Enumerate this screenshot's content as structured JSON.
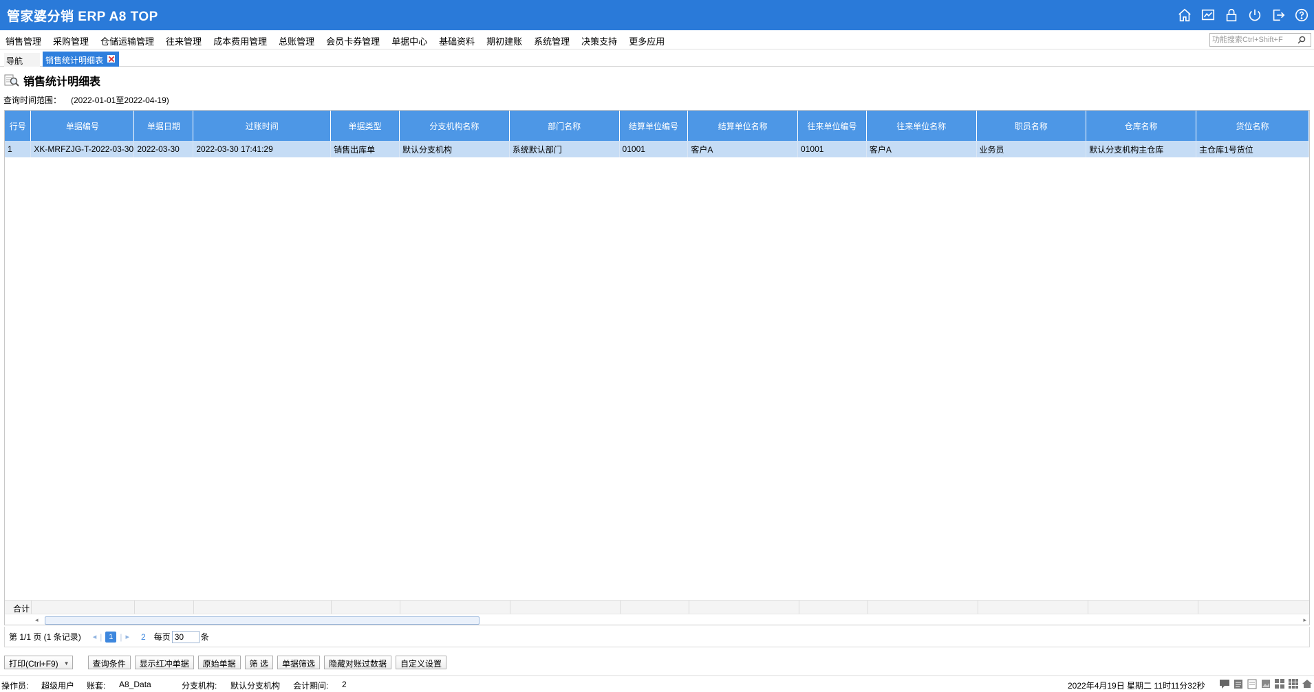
{
  "app": {
    "title": "管家婆分销 ERP A8 TOP"
  },
  "menu": [
    "销售管理",
    "采购管理",
    "仓储运输管理",
    "往来管理",
    "成本费用管理",
    "总账管理",
    "会员卡券管理",
    "单据中心",
    "基础资料",
    "期初建账",
    "系统管理",
    "决策支持",
    "更多应用"
  ],
  "search": {
    "placeholder": "功能搜索Ctrl+Shift+F"
  },
  "tabs": {
    "nav": "导航",
    "active": "销售统计明细表"
  },
  "report": {
    "title": "销售统计明细表",
    "range_label": "查询时间范围：",
    "range_value": "(2022-01-01至2022-04-19)"
  },
  "table": {
    "columns": [
      "行号",
      "单据编号",
      "单据日期",
      "过账时间",
      "单据类型",
      "分支机构名称",
      "部门名称",
      "结算单位编号",
      "结算单位名称",
      "往来单位编号",
      "往来单位名称",
      "职员名称",
      "仓库名称",
      "货位名称"
    ],
    "rows": [
      [
        "1",
        "XK-MRFZJG-T-2022-03-30",
        "2022-03-30",
        "2022-03-30 17:41:29",
        "销售出库单",
        "默认分支机构",
        "系统默认部门",
        "01001",
        "客户A",
        "01001",
        "客户A",
        "业务员",
        "默认分支机构主仓库",
        "主仓库1号货位"
      ]
    ],
    "sum_label": "合计"
  },
  "pager": {
    "info": "第  1/1 页  (1 条记录)",
    "current": "1",
    "next_num": "2",
    "per_page_label": "每页",
    "per_page": "30",
    "unit": "条"
  },
  "buttons": {
    "print": "打印(Ctrl+F9)",
    "query": "查询条件",
    "show_red": "显示红冲单据",
    "original": "原始单据",
    "filter": "筛 选",
    "bill_filter": "单据筛选",
    "hide_posted": "隐藏对账过数据",
    "custom": "自定义设置"
  },
  "status": {
    "operator_label": "操作员:",
    "operator": "超级用户",
    "account_label": "账套:",
    "account": "A8_Data",
    "branch_label": "分支机构:",
    "branch": "默认分支机构",
    "period_label": "会计期间:",
    "period": "2",
    "datetime": "2022年4月19日  星期二  11时11分32秒"
  },
  "colors": {
    "brand": "#2a7ad9",
    "header": "#4d97e6",
    "selected_row": "#c5dcf5"
  }
}
